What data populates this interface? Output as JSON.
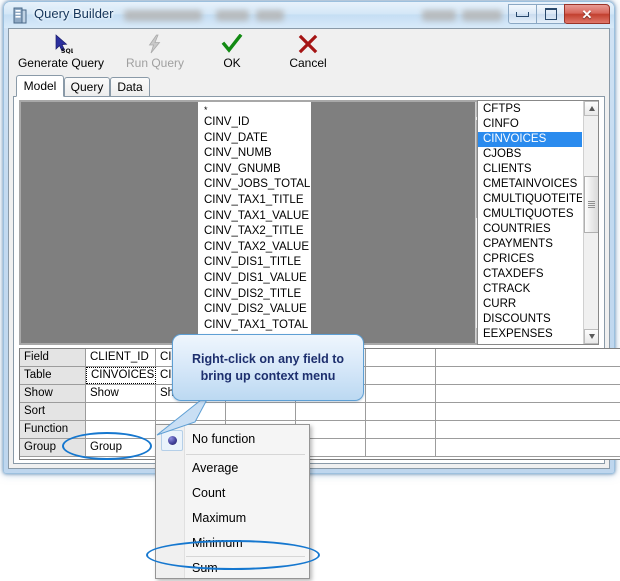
{
  "window": {
    "title": "Query Builder",
    "icon": "database-icon",
    "controls": {
      "minimize": "minimize-icon",
      "maximize": "maximize-icon",
      "close": "✕"
    }
  },
  "toolbar": {
    "items": [
      {
        "label": "Generate Query",
        "icon": "sql-cursor-icon",
        "enabled": true
      },
      {
        "label": "Run Query",
        "icon": "lightning-bolt-icon",
        "enabled": false
      },
      {
        "label": "OK",
        "icon": "checkmark-icon",
        "enabled": true
      },
      {
        "label": "Cancel",
        "icon": "cross-icon",
        "enabled": true
      }
    ]
  },
  "tabs": {
    "items": [
      {
        "label": "Model",
        "active": true
      },
      {
        "label": "Query",
        "active": false
      },
      {
        "label": "Data",
        "active": false
      }
    ]
  },
  "diagram": {
    "field_list": [
      "*",
      "CINV_ID",
      "CINV_DATE",
      "CINV_NUMB",
      "CINV_GNUMB",
      "CINV_JOBS_TOTAL",
      "CINV_TAX1_TITLE",
      "CINV_TAX1_VALUE",
      "CINV_TAX2_TITLE",
      "CINV_TAX2_VALUE",
      "CINV_DIS1_TITLE",
      "CINV_DIS1_VALUE",
      "CINV_DIS2_TITLE",
      "CINV_DIS2_VALUE",
      "CINV_TAX1_TOTAL"
    ]
  },
  "table_list": {
    "items": [
      {
        "name": "CFTPS",
        "selected": false
      },
      {
        "name": "CINFO",
        "selected": false
      },
      {
        "name": "CINVOICES",
        "selected": true
      },
      {
        "name": "CJOBS",
        "selected": false
      },
      {
        "name": "CLIENTS",
        "selected": false
      },
      {
        "name": "CMETAINVOICES",
        "selected": false
      },
      {
        "name": "CMULTIQUOTEITEMS",
        "selected": false
      },
      {
        "name": "CMULTIQUOTES",
        "selected": false
      },
      {
        "name": "COUNTRIES",
        "selected": false
      },
      {
        "name": "CPAYMENTS",
        "selected": false
      },
      {
        "name": "CPRICES",
        "selected": false
      },
      {
        "name": "CTAXDEFS",
        "selected": false
      },
      {
        "name": "CTRACK",
        "selected": false
      },
      {
        "name": "CURR",
        "selected": false
      },
      {
        "name": "DISCOUNTS",
        "selected": false
      },
      {
        "name": "EEXPENSES",
        "selected": false
      }
    ]
  },
  "grid": {
    "row_labels": [
      "Field",
      "Table",
      "Show",
      "Sort",
      "Function",
      "Group"
    ],
    "columns": [
      {
        "field": "CLIENT_ID",
        "table": "CINVOICES",
        "show": "Show",
        "sort": "",
        "function": "",
        "group": "Group"
      },
      {
        "field": "CINV",
        "table": "CINV",
        "show": "Show",
        "sort": "",
        "function": "",
        "group": ""
      }
    ]
  },
  "context_menu": {
    "items": [
      {
        "label": "No function",
        "checked": true
      },
      {
        "label": "Average",
        "checked": false
      },
      {
        "label": "Count",
        "checked": false
      },
      {
        "label": "Maximum",
        "checked": false
      },
      {
        "label": "Minimum",
        "checked": false
      },
      {
        "label": "Sum",
        "checked": false
      }
    ]
  },
  "callout": {
    "text": "Right-click on any field to bring up context menu"
  },
  "colors": {
    "accent": "#1577cf",
    "selection": "#2a8bee",
    "callout_text": "#1d2f6e"
  }
}
